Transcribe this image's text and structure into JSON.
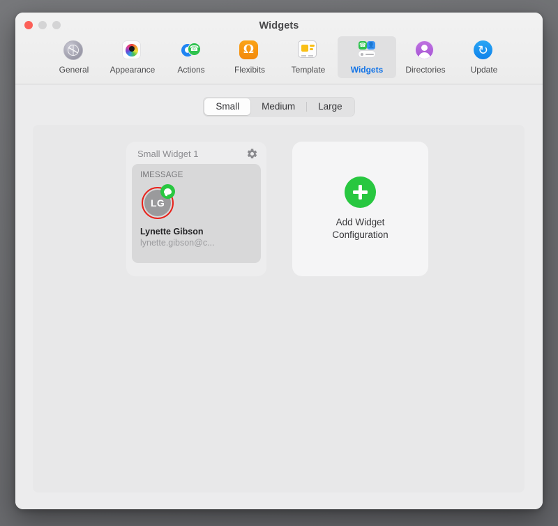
{
  "window": {
    "title": "Widgets",
    "traffic_lights": [
      "close-button",
      "minimize-button",
      "zoom-button"
    ]
  },
  "toolbar": {
    "items": [
      {
        "label": "General",
        "icon": "general-gear-icon",
        "selected": false
      },
      {
        "label": "Appearance",
        "icon": "color-wheel-icon",
        "selected": false
      },
      {
        "label": "Actions",
        "icon": "call-actions-icon",
        "selected": false
      },
      {
        "label": "Flexibits",
        "icon": "flexibits-logo-icon",
        "selected": false
      },
      {
        "label": "Template",
        "icon": "template-card-icon",
        "selected": false
      },
      {
        "label": "Widgets",
        "icon": "widgets-icon",
        "selected": true
      },
      {
        "label": "Directories",
        "icon": "person-circle-icon",
        "selected": false
      },
      {
        "label": "Update",
        "icon": "refresh-sync-icon",
        "selected": false
      }
    ],
    "selected_accent": "#1273e6"
  },
  "size_selector": {
    "options": [
      "Small",
      "Medium",
      "Large"
    ],
    "selected": "Small"
  },
  "widgets": [
    {
      "title": "Small Widget 1",
      "gear_icon": "gear-icon",
      "preview": {
        "service": "IMESSAGE",
        "avatar_initials": "LG",
        "avatar_ring_color": "#e8211a",
        "badge_icon": "imessage-bubble-icon",
        "badge_color": "#28c740",
        "name": "Lynette Gibson",
        "email": "lynette.gibson@c..."
      }
    }
  ],
  "add_card": {
    "icon": "plus-circle-icon",
    "icon_color": "#28c740",
    "label_line1": "Add Widget",
    "label_line2": "Configuration"
  }
}
